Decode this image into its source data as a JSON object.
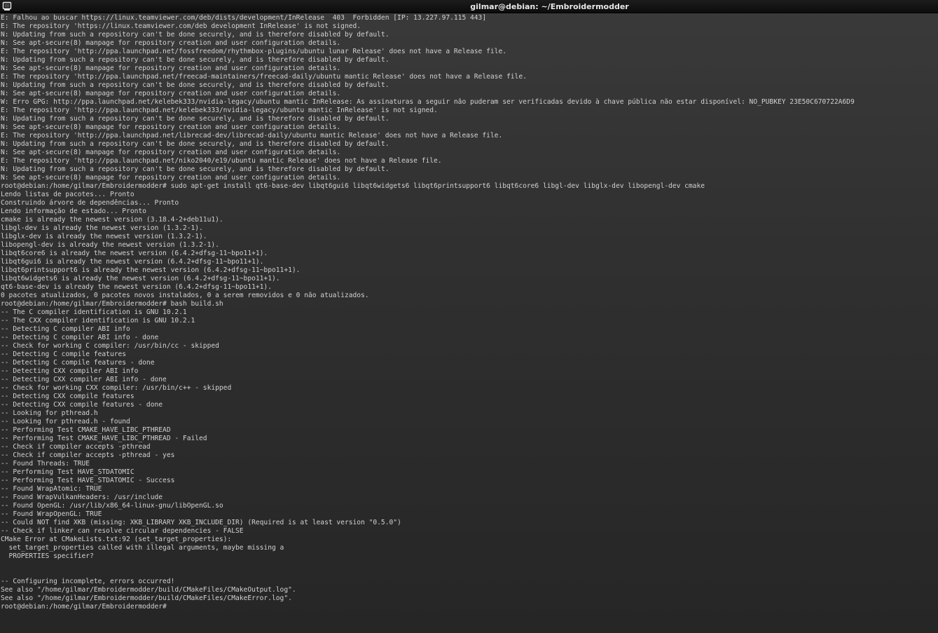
{
  "window": {
    "title": "gilmar@debian: ~/Embroidermodder",
    "icon": "terminal-icon"
  },
  "terminal": {
    "lines": [
      "E: Falhou ao buscar https://linux.teamviewer.com/deb/dists/development/InRelease  403  Forbidden [IP: 13.227.97.115 443]",
      "E: The repository 'https://linux.teamviewer.com/deb development InRelease' is not signed.",
      "N: Updating from such a repository can't be done securely, and is therefore disabled by default.",
      "N: See apt-secure(8) manpage for repository creation and user configuration details.",
      "E: The repository 'http://ppa.launchpad.net/fossfreedom/rhythmbox-plugins/ubuntu lunar Release' does not have a Release file.",
      "N: Updating from such a repository can't be done securely, and is therefore disabled by default.",
      "N: See apt-secure(8) manpage for repository creation and user configuration details.",
      "E: The repository 'http://ppa.launchpad.net/freecad-maintainers/freecad-daily/ubuntu mantic Release' does not have a Release file.",
      "N: Updating from such a repository can't be done securely, and is therefore disabled by default.",
      "N: See apt-secure(8) manpage for repository creation and user configuration details.",
      "W: Erro GPG: http://ppa.launchpad.net/kelebek333/nvidia-legacy/ubuntu mantic InRelease: As assinaturas a seguir não puderam ser verificadas devido à chave pública não estar disponível: NO_PUBKEY 23E50C670722A6D9",
      "E: The repository 'http://ppa.launchpad.net/kelebek333/nvidia-legacy/ubuntu mantic InRelease' is not signed.",
      "N: Updating from such a repository can't be done securely, and is therefore disabled by default.",
      "N: See apt-secure(8) manpage for repository creation and user configuration details.",
      "E: The repository 'http://ppa.launchpad.net/librecad-dev/librecad-daily/ubuntu mantic Release' does not have a Release file.",
      "N: Updating from such a repository can't be done securely, and is therefore disabled by default.",
      "N: See apt-secure(8) manpage for repository creation and user configuration details.",
      "E: The repository 'http://ppa.launchpad.net/niko2040/e19/ubuntu mantic Release' does not have a Release file.",
      "N: Updating from such a repository can't be done securely, and is therefore disabled by default.",
      "N: See apt-secure(8) manpage for repository creation and user configuration details.",
      "root@debian:/home/gilmar/Embroidermodder# sudo apt-get install qt6-base-dev libqt6gui6 libqt6widgets6 libqt6printsupport6 libqt6core6 libgl-dev libglx-dev libopengl-dev cmake",
      "Lendo listas de pacotes... Pronto",
      "Construindo árvore de dependências... Pronto",
      "Lendo informação de estado... Pronto",
      "cmake is already the newest version (3.18.4-2+deb11u1).",
      "libgl-dev is already the newest version (1.3.2-1).",
      "libglx-dev is already the newest version (1.3.2-1).",
      "libopengl-dev is already the newest version (1.3.2-1).",
      "libqt6core6 is already the newest version (6.4.2+dfsg-11~bpo11+1).",
      "libqt6gui6 is already the newest version (6.4.2+dfsg-11~bpo11+1).",
      "libqt6printsupport6 is already the newest version (6.4.2+dfsg-11~bpo11+1).",
      "libqt6widgets6 is already the newest version (6.4.2+dfsg-11~bpo11+1).",
      "qt6-base-dev is already the newest version (6.4.2+dfsg-11~bpo11+1).",
      "0 pacotes atualizados, 0 pacotes novos instalados, 0 a serem removidos e 0 não atualizados.",
      "root@debian:/home/gilmar/Embroidermodder# bash build.sh",
      "-- The C compiler identification is GNU 10.2.1",
      "-- The CXX compiler identification is GNU 10.2.1",
      "-- Detecting C compiler ABI info",
      "-- Detecting C compiler ABI info - done",
      "-- Check for working C compiler: /usr/bin/cc - skipped",
      "-- Detecting C compile features",
      "-- Detecting C compile features - done",
      "-- Detecting CXX compiler ABI info",
      "-- Detecting CXX compiler ABI info - done",
      "-- Check for working CXX compiler: /usr/bin/c++ - skipped",
      "-- Detecting CXX compile features",
      "-- Detecting CXX compile features - done",
      "-- Looking for pthread.h",
      "-- Looking for pthread.h - found",
      "-- Performing Test CMAKE_HAVE_LIBC_PTHREAD",
      "-- Performing Test CMAKE_HAVE_LIBC_PTHREAD - Failed",
      "-- Check if compiler accepts -pthread",
      "-- Check if compiler accepts -pthread - yes",
      "-- Found Threads: TRUE",
      "-- Performing Test HAVE_STDATOMIC",
      "-- Performing Test HAVE_STDATOMIC - Success",
      "-- Found WrapAtomic: TRUE",
      "-- Found WrapVulkanHeaders: /usr/include",
      "-- Found OpenGL: /usr/lib/x86_64-linux-gnu/libOpenGL.so",
      "-- Found WrapOpenGL: TRUE",
      "-- Could NOT find XKB (missing: XKB_LIBRARY XKB_INCLUDE_DIR) (Required is at least version \"0.5.0\")",
      "-- Check if linker can resolve circular dependencies - FALSE",
      "CMake Error at CMakeLists.txt:92 (set_target_properties):",
      "  set_target_properties called with illegal arguments, maybe missing a",
      "  PROPERTIES specifier?",
      "",
      "",
      "-- Configuring incomplete, errors occurred!",
      "See also \"/home/gilmar/Embroidermodder/build/CMakeFiles/CMakeOutput.log\".",
      "See also \"/home/gilmar/Embroidermodder/build/CMakeFiles/CMakeError.log\".",
      "root@debian:/home/gilmar/Embroidermodder# "
    ]
  }
}
